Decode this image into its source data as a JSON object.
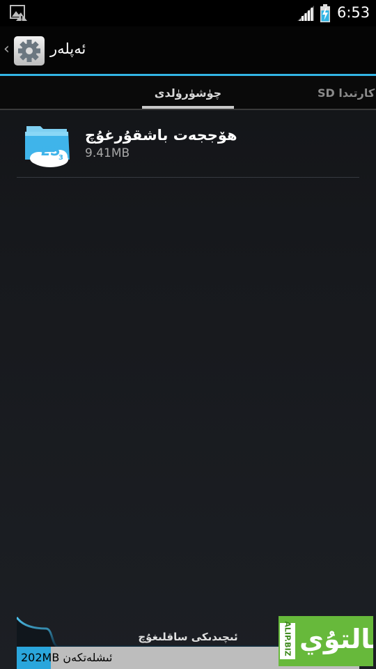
{
  "status_bar": {
    "time": "6:53"
  },
  "action_bar": {
    "title": "ئەپلەر",
    "up_glyph": "‹"
  },
  "tabs": [
    {
      "label": "چۈشۈرۈلدى",
      "active": true
    },
    {
      "label": "SD كارتىدا",
      "active": false
    }
  ],
  "apps": [
    {
      "name": "ھۆججەت باشقۇرغۇچ",
      "size": "9.41MB",
      "icon": "es-file-explorer-icon"
    }
  ],
  "storage": {
    "label": "ئىچىدىكى ساقلىغۇچ",
    "used_text": "202MB ئىشلەتكەن",
    "used_fraction": 0.1
  },
  "watermark": {
    "main_text": "ئالتۇي",
    "side_text": "ALIP.BIZ"
  },
  "colors": {
    "accent": "#33b5e5",
    "storage_fill": "#2aa6dc",
    "watermark_bg": "#67b93b"
  }
}
